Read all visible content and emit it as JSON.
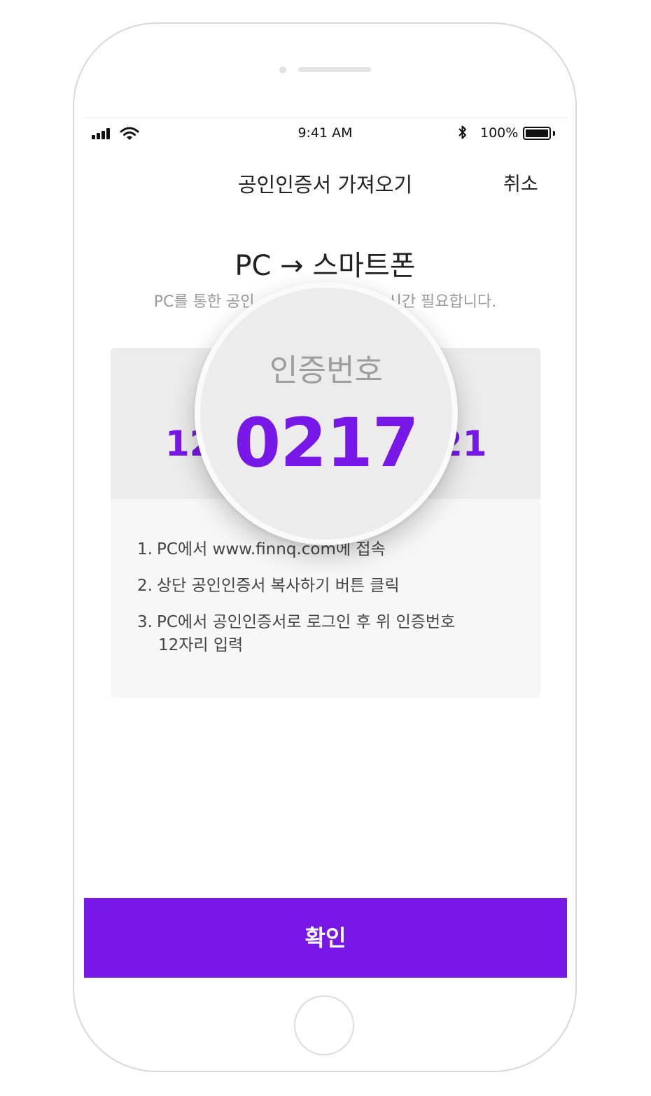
{
  "status_bar": {
    "time": "9:41 AM",
    "bluetooth_icon": "bluetooth-icon",
    "battery_percent": "100%",
    "battery_level": 1.0
  },
  "nav": {
    "title": "공인인증서 가져오기",
    "cancel_label": "취소"
  },
  "headline": "PC → 스마트폰",
  "subtitle": {
    "left": "PC를 통한 공인",
    "right": "시간 필요합니다."
  },
  "code_card": {
    "code_left": "12",
    "code_right": "21",
    "steps": [
      {
        "num": "1.",
        "text": "PC에서 www.finnq.com에 접속"
      },
      {
        "num": "2.",
        "text": "상단 공인인증서 복사하기 버튼 클릭"
      },
      {
        "num": "3.",
        "text": "PC에서 공인인증서로 로그인 후 위 인증번호",
        "cont": "12자리 입력"
      }
    ]
  },
  "magnifier": {
    "label": "인증번호",
    "code": "0217"
  },
  "confirm_label": "확인",
  "colors": {
    "accent": "#7718e8",
    "card_top": "#ececec",
    "card_bottom": "#f7f7f7"
  }
}
